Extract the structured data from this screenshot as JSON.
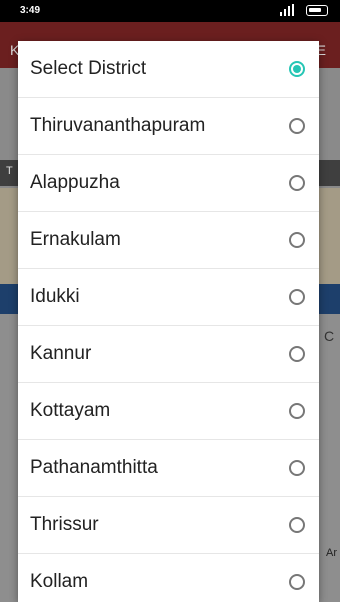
{
  "status_bar": {
    "time": "3:49"
  },
  "background": {
    "header_left": "K",
    "header_right": "E",
    "strip_text": "T",
    "right_text": "Ar",
    "right_c": "C"
  },
  "dialog": {
    "options": [
      {
        "label": "Select District",
        "selected": true
      },
      {
        "label": "Thiruvananthapuram",
        "selected": false
      },
      {
        "label": "Alappuzha",
        "selected": false
      },
      {
        "label": "Ernakulam",
        "selected": false
      },
      {
        "label": "Idukki",
        "selected": false
      },
      {
        "label": "Kannur",
        "selected": false
      },
      {
        "label": "Kottayam",
        "selected": false
      },
      {
        "label": "Pathanamthitta",
        "selected": false
      },
      {
        "label": "Thrissur",
        "selected": false
      },
      {
        "label": "Kollam",
        "selected": false
      }
    ]
  },
  "colors": {
    "accent": "#26c6b5",
    "radio_border": "#777777"
  }
}
